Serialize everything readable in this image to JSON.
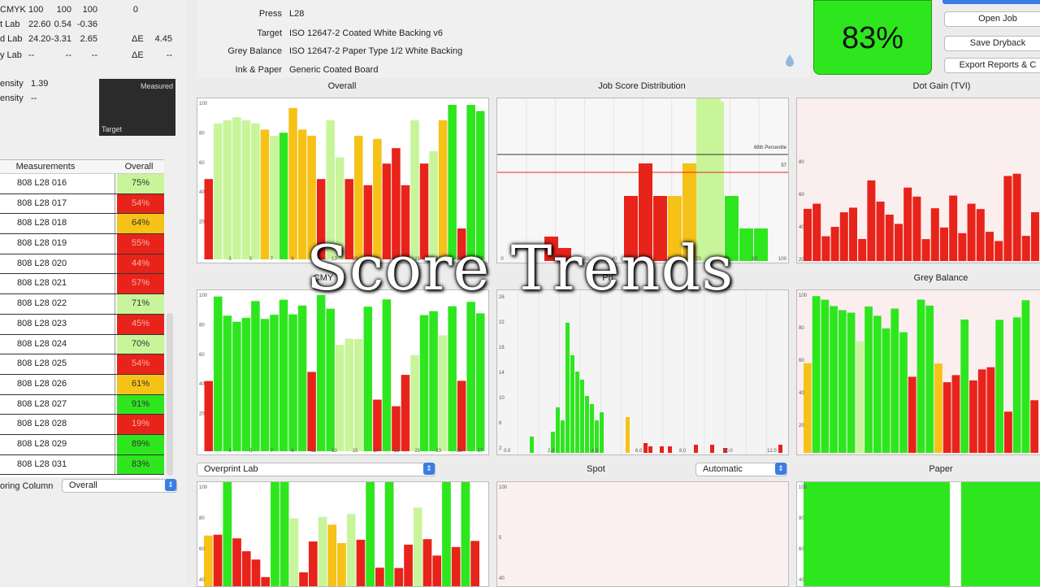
{
  "left_panel": {
    "readouts": [
      {
        "label": "CMYK",
        "values": [
          "100",
          "100",
          "100",
          "0"
        ],
        "de_label": "",
        "de_value": ""
      },
      {
        "label": "t Lab",
        "values": [
          "22.60",
          "0.54",
          "-0.36"
        ],
        "de_label": "",
        "de_value": ""
      },
      {
        "label": "d Lab",
        "values": [
          "24.20",
          "-3.31",
          "2.65"
        ],
        "de_label": "ΔE",
        "de_value": "4.45"
      },
      {
        "label": "y Lab",
        "values": [
          "--",
          "--",
          "--"
        ],
        "de_label": "ΔE",
        "de_value": "--"
      }
    ],
    "density_rows": [
      {
        "label": "ensity",
        "value": "1.39"
      },
      {
        "label": "ensity",
        "value": "--"
      }
    ],
    "swatch": {
      "top_label": "Measured",
      "bottom_label": "Target"
    },
    "table": {
      "headers": [
        "Measurements",
        "Overall"
      ],
      "rows": [
        {
          "name": "808 L28 016",
          "score": "75%",
          "color": "#c8f59a"
        },
        {
          "name": "808 L28 017",
          "score": "54%",
          "color": "#e8231a"
        },
        {
          "name": "808 L28 018",
          "score": "64%",
          "color": "#f6c218"
        },
        {
          "name": "808 L28 019",
          "score": "55%",
          "color": "#e8231a"
        },
        {
          "name": "808 L28 020",
          "score": "44%",
          "color": "#e8231a"
        },
        {
          "name": "808 L28 021",
          "score": "57%",
          "color": "#e8231a"
        },
        {
          "name": "808 L28 022",
          "score": "71%",
          "color": "#c8f59a"
        },
        {
          "name": "808 L28 023",
          "score": "45%",
          "color": "#e8231a"
        },
        {
          "name": "808 L28 024",
          "score": "70%",
          "color": "#c8f59a"
        },
        {
          "name": "808 L28 025",
          "score": "54%",
          "color": "#e8231a"
        },
        {
          "name": "808 L28 026",
          "score": "61%",
          "color": "#f6c218"
        },
        {
          "name": "808 L28 027",
          "score": "91%",
          "color": "#2ee61e"
        },
        {
          "name": "808 L28 028",
          "score": "19%",
          "color": "#e8231a"
        },
        {
          "name": "808 L28 029",
          "score": "89%",
          "color": "#2ee61e"
        },
        {
          "name": "808 L28 031",
          "score": "83%",
          "color": "#2ee61e"
        }
      ]
    },
    "sorting": {
      "label": "oring Column",
      "value": "Overall"
    }
  },
  "info": {
    "rows": [
      {
        "key": "Press",
        "value": "L28"
      },
      {
        "key": "Target",
        "value": "ISO 12647-2 Coated White Backing v6"
      },
      {
        "key": "Grey Balance",
        "value": "ISO 12647-2 Paper Type 1/2 White Backing"
      },
      {
        "key": "Ink & Paper",
        "value": "Generic Coated Board"
      }
    ]
  },
  "score": {
    "value": "83%"
  },
  "buttons": {
    "open_job": "Open Job",
    "save": "Save Dryback",
    "export": "Export Reports & C"
  },
  "overlay_title": "Score Trends",
  "chart_titles": {
    "overall": "Overall",
    "distribution": "Job Score Distribution",
    "dot_gain": "Dot Gain (TVI)",
    "cmyk": "CMY",
    "primary": "Pri",
    "grey": "Grey Balance",
    "spot": "Spot",
    "paper": "Paper"
  },
  "dropdowns": {
    "overprint": "Overprint Lab",
    "automatic": "Automatic"
  },
  "colors": {
    "green": "#2ee61e",
    "light_green": "#c8f59a",
    "yellow": "#f6c218",
    "red": "#e8231a"
  },
  "chart_data": [
    {
      "type": "bar",
      "name": "Overall",
      "ylim": [
        0,
        100
      ],
      "yticks": [
        "100",
        "80",
        "60",
        "40",
        "20"
      ],
      "xticks": [
        "3",
        "5",
        "7",
        "9",
        "11",
        "13",
        "15",
        "17",
        "19",
        "21",
        "23",
        "25",
        "27"
      ],
      "values": [
        52,
        88,
        90,
        92,
        90,
        88,
        84,
        80,
        82,
        98,
        84,
        80,
        52,
        90,
        66,
        52,
        80,
        48,
        78,
        62,
        72,
        48,
        90,
        62,
        70,
        90,
        100,
        20,
        100,
        96
      ],
      "colors": [
        "r",
        "l",
        "l",
        "l",
        "l",
        "l",
        "y",
        "l",
        "g",
        "y",
        "y",
        "y",
        "r",
        "l",
        "l",
        "r",
        "y",
        "r",
        "y",
        "r",
        "r",
        "r",
        "l",
        "r",
        "l",
        "y",
        "g",
        "r",
        "g",
        "g"
      ]
    },
    {
      "type": "bar",
      "name": "Job Score Distribution",
      "xticks": [
        "0",
        "10",
        "20",
        "30",
        "40",
        "50",
        "60",
        "70",
        "80",
        "90",
        "100"
      ],
      "labels": [
        "68th Percentile",
        "57"
      ],
      "note": "partially obscured"
    },
    {
      "type": "bar",
      "name": "Dot Gain (TVI)",
      "yticks": [
        "80",
        "60",
        "40",
        "20"
      ],
      "note": "red bars"
    },
    {
      "type": "bar",
      "name": "CMYK",
      "yticks": [
        "100",
        "80",
        "60",
        "40",
        "20"
      ],
      "xticks": [
        "3",
        "5",
        "7",
        "9",
        "11",
        "13",
        "15",
        "17",
        "19",
        "21",
        "23",
        "25",
        "27"
      ]
    },
    {
      "type": "bar",
      "name": "Primary ΔE",
      "xticks": [
        "0.0",
        "2.0",
        "4.0",
        "6.0",
        "8.0",
        "10.0",
        "12.0"
      ],
      "yticks": [
        "26",
        "22",
        "18",
        "14",
        "10",
        "6",
        "2"
      ]
    },
    {
      "type": "bar",
      "name": "Grey Balance",
      "yticks": [
        "100",
        "80",
        "60",
        "40",
        "20"
      ],
      "xticks": [
        "1",
        "3",
        "5",
        "7",
        "9",
        "11",
        "13",
        "15",
        "17",
        "19",
        "21",
        "23",
        "25",
        "27"
      ]
    }
  ]
}
